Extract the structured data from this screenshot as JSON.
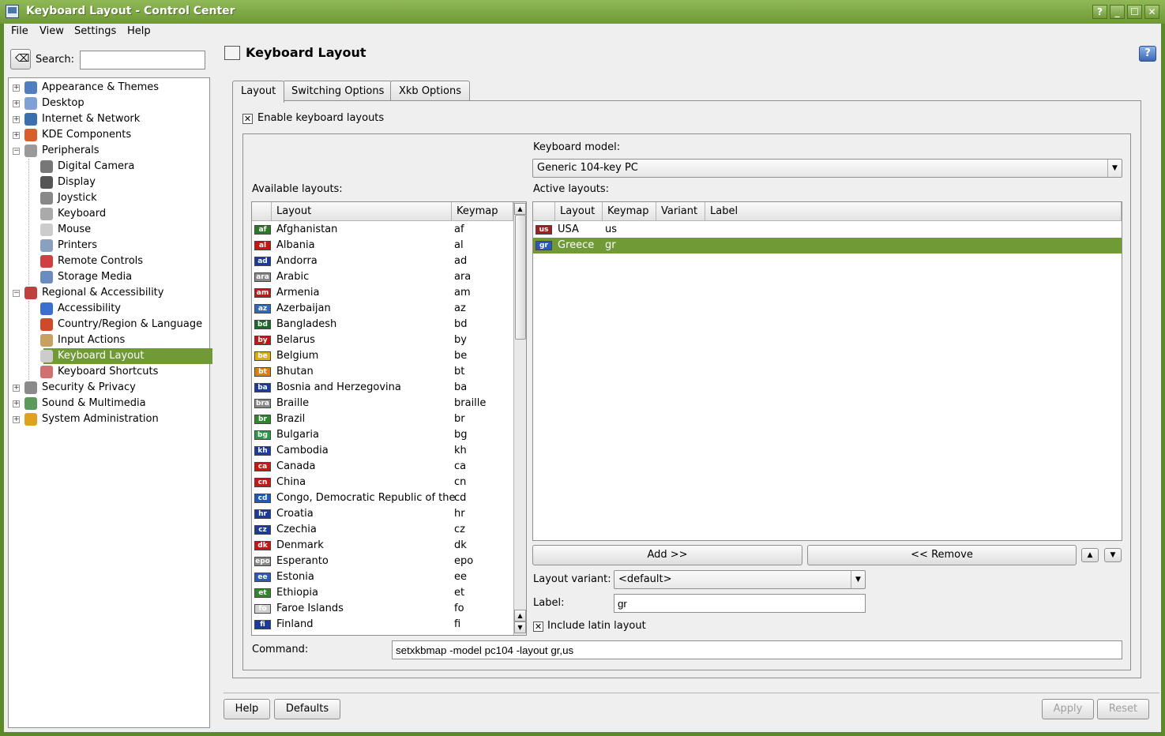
{
  "window": {
    "title": "Keyboard Layout - Control Center",
    "buttons": [
      "?",
      "_",
      "☐",
      "✕"
    ]
  },
  "menu": [
    "File",
    "View",
    "Settings",
    "Help"
  ],
  "search": {
    "label": "Search:",
    "value": ""
  },
  "tree": [
    {
      "label": "Appearance & Themes",
      "level": 0,
      "expander": "+",
      "color": "#4f7fc0"
    },
    {
      "label": "Desktop",
      "level": 0,
      "expander": "+",
      "color": "#7fa2d6"
    },
    {
      "label": "Internet & Network",
      "level": 0,
      "expander": "+",
      "color": "#3a6fb0"
    },
    {
      "label": "KDE Components",
      "level": 0,
      "expander": "+",
      "color": "#d95f2a"
    },
    {
      "label": "Peripherals",
      "level": 0,
      "expander": "−",
      "color": "#9a9a9a"
    },
    {
      "label": "Digital Camera",
      "level": 1,
      "color": "#777777"
    },
    {
      "label": "Display",
      "level": 1,
      "color": "#555555"
    },
    {
      "label": "Joystick",
      "level": 1,
      "color": "#888888"
    },
    {
      "label": "Keyboard",
      "level": 1,
      "color": "#aaaaaa"
    },
    {
      "label": "Mouse",
      "level": 1,
      "color": "#cccccc"
    },
    {
      "label": "Printers",
      "level": 1,
      "color": "#8aa0c0"
    },
    {
      "label": "Remote Controls",
      "level": 1,
      "color": "#d04040"
    },
    {
      "label": "Storage Media",
      "level": 1,
      "color": "#6a8cc0"
    },
    {
      "label": "Regional & Accessibility",
      "level": 0,
      "expander": "−",
      "color": "#c04040"
    },
    {
      "label": "Accessibility",
      "level": 1,
      "color": "#3a6fd0"
    },
    {
      "label": "Country/Region & Language",
      "level": 1,
      "color": "#d04a2a"
    },
    {
      "label": "Input Actions",
      "level": 1,
      "color": "#c8a060"
    },
    {
      "label": "Keyboard Layout",
      "level": 1,
      "color": "#cccccc",
      "selected": true
    },
    {
      "label": "Keyboard Shortcuts",
      "level": 1,
      "color": "#d07070"
    },
    {
      "label": "Security & Privacy",
      "level": 0,
      "expander": "+",
      "color": "#8a8a8a"
    },
    {
      "label": "Sound & Multimedia",
      "level": 0,
      "expander": "+",
      "color": "#5a9a5a"
    },
    {
      "label": "System Administration",
      "level": 0,
      "expander": "+",
      "color": "#e0a020"
    }
  ],
  "page": {
    "title": "Keyboard Layout",
    "help_icon": "?"
  },
  "tabs": [
    "Layout",
    "Switching Options",
    "Xkb Options"
  ],
  "enable_layouts": {
    "label": "Enable keyboard layouts",
    "checked": true
  },
  "keyboard_model": {
    "label": "Keyboard model:",
    "value": "Generic 104-key PC"
  },
  "available": {
    "label": "Available layouts:",
    "columns": [
      "Layout",
      "Keymap"
    ],
    "rows": [
      {
        "flag": "af",
        "name": "Afghanistan",
        "keymap": "af",
        "color": "#2a7a2a"
      },
      {
        "flag": "al",
        "name": "Albania",
        "keymap": "al",
        "color": "#c81414"
      },
      {
        "flag": "ad",
        "name": "Andorra",
        "keymap": "ad",
        "color": "#1a3aa0"
      },
      {
        "flag": "ara",
        "name": "Arabic",
        "keymap": "ara",
        "color": "#888888"
      },
      {
        "flag": "am",
        "name": "Armenia",
        "keymap": "am",
        "color": "#c81414"
      },
      {
        "flag": "az",
        "name": "Azerbaijan",
        "keymap": "az",
        "color": "#2a6ac0"
      },
      {
        "flag": "bd",
        "name": "Bangladesh",
        "keymap": "bd",
        "color": "#1a6a2a"
      },
      {
        "flag": "by",
        "name": "Belarus",
        "keymap": "by",
        "color": "#c81414"
      },
      {
        "flag": "be",
        "name": "Belgium",
        "keymap": "be",
        "color": "#e0b000"
      },
      {
        "flag": "bt",
        "name": "Bhutan",
        "keymap": "bt",
        "color": "#e08000"
      },
      {
        "flag": "ba",
        "name": "Bosnia and Herzegovina",
        "keymap": "ba",
        "color": "#1a3aa0"
      },
      {
        "flag": "bra",
        "name": "Braille",
        "keymap": "braille",
        "color": "#888888"
      },
      {
        "flag": "br",
        "name": "Brazil",
        "keymap": "br",
        "color": "#2a8a2a"
      },
      {
        "flag": "bg",
        "name": "Bulgaria",
        "keymap": "bg",
        "color": "#2a9a4a"
      },
      {
        "flag": "kh",
        "name": "Cambodia",
        "keymap": "kh",
        "color": "#1a3aa0"
      },
      {
        "flag": "ca",
        "name": "Canada",
        "keymap": "ca",
        "color": "#d01414"
      },
      {
        "flag": "cn",
        "name": "China",
        "keymap": "cn",
        "color": "#d01414"
      },
      {
        "flag": "cd",
        "name": "Congo, Democratic Republic of the",
        "keymap": "cd",
        "color": "#1a5ac0"
      },
      {
        "flag": "hr",
        "name": "Croatia",
        "keymap": "hr",
        "color": "#1a3aa0"
      },
      {
        "flag": "cz",
        "name": "Czechia",
        "keymap": "cz",
        "color": "#1a3aa0"
      },
      {
        "flag": "dk",
        "name": "Denmark",
        "keymap": "dk",
        "color": "#c81414"
      },
      {
        "flag": "epo",
        "name": "Esperanto",
        "keymap": "epo",
        "color": "#888888"
      },
      {
        "flag": "ee",
        "name": "Estonia",
        "keymap": "ee",
        "color": "#2a5ac0"
      },
      {
        "flag": "et",
        "name": "Ethiopia",
        "keymap": "et",
        "color": "#2a8a2a"
      },
      {
        "flag": "fo",
        "name": "Faroe Islands",
        "keymap": "fo",
        "color": "#d0d0d0"
      },
      {
        "flag": "fi",
        "name": "Finland",
        "keymap": "fi",
        "color": "#1a3aa0"
      }
    ]
  },
  "active": {
    "label": "Active layouts:",
    "columns": [
      "Layout",
      "Keymap",
      "Variant",
      "Label"
    ],
    "rows": [
      {
        "flag": "us",
        "name": "USA",
        "keymap": "us",
        "variant": "",
        "label": "",
        "color": "#a02020"
      },
      {
        "flag": "gr",
        "name": "Greece",
        "keymap": "gr",
        "variant": "",
        "label": "",
        "color": "#2a5ac0",
        "selected": true
      }
    ]
  },
  "add_button": "Add >>",
  "remove_button": "<< Remove",
  "layout_variant": {
    "label": "Layout variant:",
    "value": "<default>"
  },
  "label_field": {
    "label": "Label:",
    "value": "gr"
  },
  "include_latin": {
    "label": "Include latin layout",
    "checked": true
  },
  "command": {
    "label": "Command:",
    "value": "setxkbmap -model pc104 -layout gr,us"
  },
  "bottom_buttons": {
    "help": "Help",
    "defaults": "Defaults",
    "apply": "Apply",
    "reset": "Reset"
  },
  "colors": {
    "accent": "#6f9a36",
    "annotation_arrow": "#d01414"
  }
}
